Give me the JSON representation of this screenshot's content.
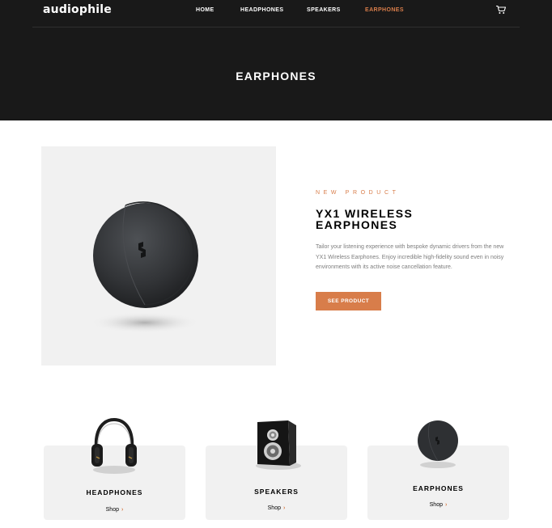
{
  "header": {
    "logo": "audiophile",
    "nav": [
      {
        "label": "HOME",
        "active": false
      },
      {
        "label": "HEADPHONES",
        "active": false
      },
      {
        "label": "SPEAKERS",
        "active": false
      },
      {
        "label": "EARPHONES",
        "active": true
      }
    ],
    "cart_icon": "cart-icon"
  },
  "hero": {
    "title": "EARPHONES"
  },
  "product": {
    "overline": "NEW PRODUCT",
    "name_line1": "YX1 WIRELESS",
    "name_line2": "EARPHONES",
    "description": "Tailor your listening experience with bespoke dynamic drivers from the new YX1 Wireless Earphones. Enjoy incredible high-fidelity sound even in noisy environments with its active noise cancellation feature.",
    "button_label": "SEE PRODUCT"
  },
  "categories": [
    {
      "name": "HEADPHONES",
      "shop_label": "Shop",
      "chevron": "›"
    },
    {
      "name": "SPEAKERS",
      "shop_label": "Shop",
      "chevron": "›"
    },
    {
      "name": "EARPHONES",
      "shop_label": "Shop",
      "chevron": "›"
    }
  ],
  "colors": {
    "accent": "#d87d4a",
    "dark": "#191919",
    "light_gray": "#f1f1f1"
  }
}
